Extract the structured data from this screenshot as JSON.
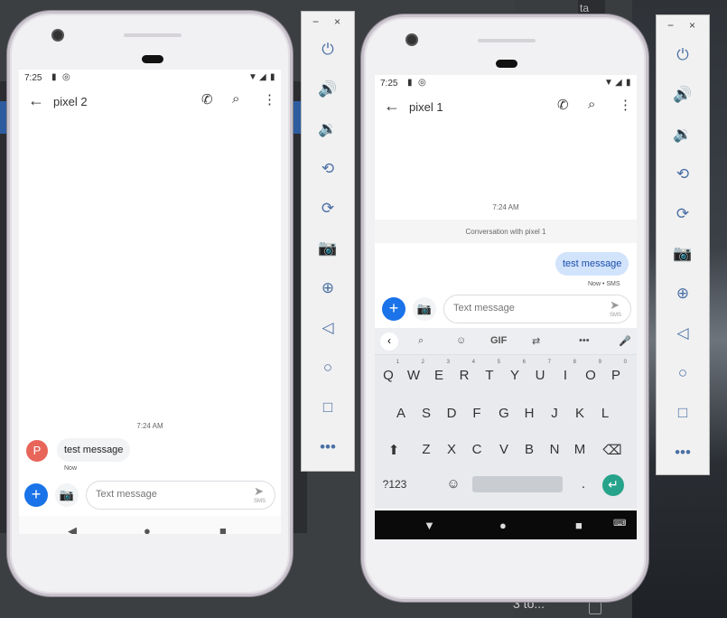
{
  "desktop": {
    "top_text": "ta",
    "bottom_text": "3 to..."
  },
  "phone_left": {
    "status": {
      "time": "7:25"
    },
    "appbar": {
      "title": "pixel 2"
    },
    "timestamp": "7:24 AM",
    "avatar_letter": "P",
    "message": {
      "text": "test message",
      "meta": "Now"
    },
    "compose": {
      "placeholder": "Text message",
      "send_sub": "SMS"
    }
  },
  "phone_right": {
    "status": {
      "time": "7:25"
    },
    "appbar": {
      "title": "pixel 1"
    },
    "timestamp": "7:24 AM",
    "conversation_label": "Conversation with pixel 1",
    "message": {
      "text": "test message",
      "meta": "Now • SMS"
    },
    "compose": {
      "placeholder": "Text message",
      "send_sub": "SMS"
    },
    "keyboard": {
      "gif_label": "GIF",
      "row1": [
        "Q",
        "W",
        "E",
        "R",
        "T",
        "Y",
        "U",
        "I",
        "O",
        "P"
      ],
      "row1_nums": [
        "1",
        "2",
        "3",
        "4",
        "5",
        "6",
        "7",
        "8",
        "9",
        "0"
      ],
      "row2": [
        "A",
        "S",
        "D",
        "F",
        "G",
        "H",
        "J",
        "K",
        "L"
      ],
      "row3": [
        "Z",
        "X",
        "C",
        "V",
        "B",
        "N",
        "M"
      ],
      "symbols_key": "?123",
      "period_key": "."
    }
  },
  "emulator_panel": {
    "buttons": [
      "power-icon",
      "volume-up-icon",
      "volume-down-icon",
      "rotate-left-icon",
      "rotate-right-icon",
      "camera-icon",
      "zoom-icon",
      "back-icon",
      "home-icon",
      "overview-icon",
      "more-icon"
    ]
  }
}
